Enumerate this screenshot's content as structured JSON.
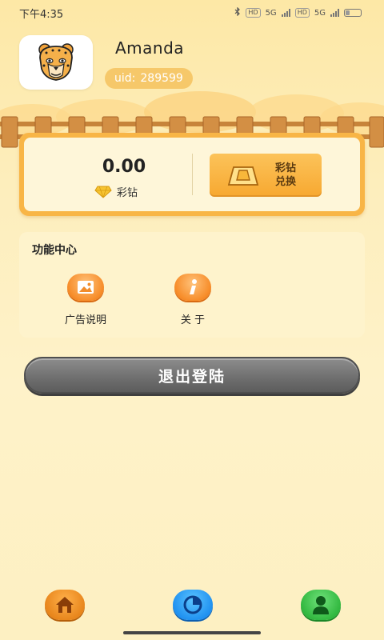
{
  "status_bar": {
    "time": "下午4:35",
    "network_1": "5G",
    "network_2": "5G",
    "battery": "30",
    "battery_level": 0.3
  },
  "profile": {
    "username": "Amanda",
    "uid_label": "uid:",
    "uid_value": "289599",
    "avatar_icon": "leopard-avatar-icon"
  },
  "balance": {
    "amount": "0.00",
    "currency_label": "彩钻",
    "exchange_line1": "彩钻",
    "exchange_line2": "兑换"
  },
  "function_center": {
    "title": "功能中心",
    "items": [
      {
        "label": "广告说明",
        "icon": "image-icon"
      },
      {
        "label": "关 于",
        "icon": "info-icon"
      }
    ]
  },
  "logout": {
    "label": "退出登陆"
  },
  "bottom_nav": [
    {
      "icon": "home-icon"
    },
    {
      "icon": "pie-chart-icon"
    },
    {
      "icon": "user-icon"
    }
  ],
  "colors": {
    "accent_orange": "#f8b546",
    "background": "#fde8a6",
    "logout_gray": "#6e6e6e"
  }
}
